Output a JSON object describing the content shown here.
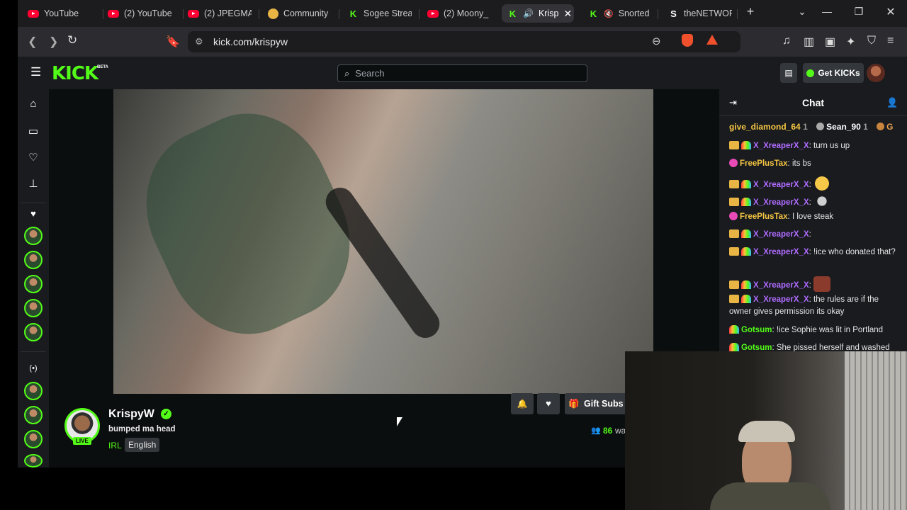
{
  "browser": {
    "tabs": [
      {
        "label": "YouTube",
        "icon": "youtube-icon"
      },
      {
        "label": "(2) YouTube",
        "icon": "youtube-icon"
      },
      {
        "label": "(2) JPEGMA",
        "icon": "youtube-icon"
      },
      {
        "label": "Community",
        "icon": "crunchyroll-icon"
      },
      {
        "label": "Sogee Strea",
        "icon": "kick-icon"
      },
      {
        "label": "(2) Moony_",
        "icon": "youtube-icon"
      },
      {
        "label": "Krisp",
        "icon": "kick-icon"
      },
      {
        "label": "Snorted",
        "icon": "kick-icon"
      },
      {
        "label": "theNETWOR",
        "icon": "s-icon"
      }
    ],
    "url": "kick.com/krispyw"
  },
  "kick": {
    "logo": "KICK",
    "logo_badge": "BETA",
    "search_placeholder": "Search",
    "get_kicks": "Get KICKs"
  },
  "stream": {
    "streamer": "KrispyW",
    "title": "bumped ma head",
    "category": "IRL",
    "language": "English",
    "live_badge": "LIVE",
    "gift_subs": "Gift Subs",
    "viewers": "86",
    "viewers_suffix": "wa"
  },
  "chat": {
    "title": "Chat",
    "gifters": [
      {
        "name": "give_diamond_64",
        "count": "1"
      },
      {
        "name": "Sean_90",
        "count": "1"
      },
      {
        "name": "G",
        "count": ""
      }
    ],
    "messages": [
      {
        "user": "X_XreaperX_X",
        "text": "turn us up",
        "color": "#b06cff",
        "badges": [
          "crown",
          "rainbow"
        ]
      },
      {
        "user": "FreePlusTax",
        "text": "its bs",
        "color": "#f5c542",
        "badges": [
          "sub"
        ]
      },
      {
        "user": "X_XreaperX_X",
        "text": "",
        "color": "#b06cff",
        "badges": [
          "crown",
          "rainbow"
        ],
        "emote": "surprised-emote"
      },
      {
        "user": "X_XreaperX_X",
        "text": "",
        "color": "#b06cff",
        "badges": [
          "crown",
          "rainbow"
        ],
        "emote": "cat-emote"
      },
      {
        "user": "FreePlusTax",
        "text": "I love steak",
        "color": "#f5c542",
        "badges": [
          "sub"
        ]
      },
      {
        "user": "X_XreaperX_X",
        "text": "",
        "color": "#b06cff",
        "badges": [
          "crown",
          "rainbow"
        ]
      },
      {
        "user": "X_XreaperX_X",
        "text": "!ice who donated that?",
        "color": "#b06cff",
        "badges": [
          "crown",
          "rainbow"
        ]
      },
      {
        "user": "X_XreaperX_X",
        "text": "",
        "color": "#b06cff",
        "badges": [
          "crown",
          "rainbow"
        ],
        "emote": "face-emote"
      },
      {
        "user": "X_XreaperX_X",
        "text": "the rules are if the owner gives permission its okay",
        "color": "#b06cff",
        "badges": [
          "crown",
          "rainbow"
        ]
      },
      {
        "user": "Gotsum",
        "text": "!ice Sophie was lit in Portland",
        "color": "#53fc18",
        "badges": [
          "rainbow"
        ]
      },
      {
        "user": "Gotsum",
        "text": "She pissed herself and washed",
        "color": "#53fc18",
        "badges": [
          "rainbow"
        ]
      }
    ]
  },
  "colors": {
    "brand": "#53fc18",
    "page_bg": "#0b0e0f",
    "panel_bg": "#191b1f"
  }
}
